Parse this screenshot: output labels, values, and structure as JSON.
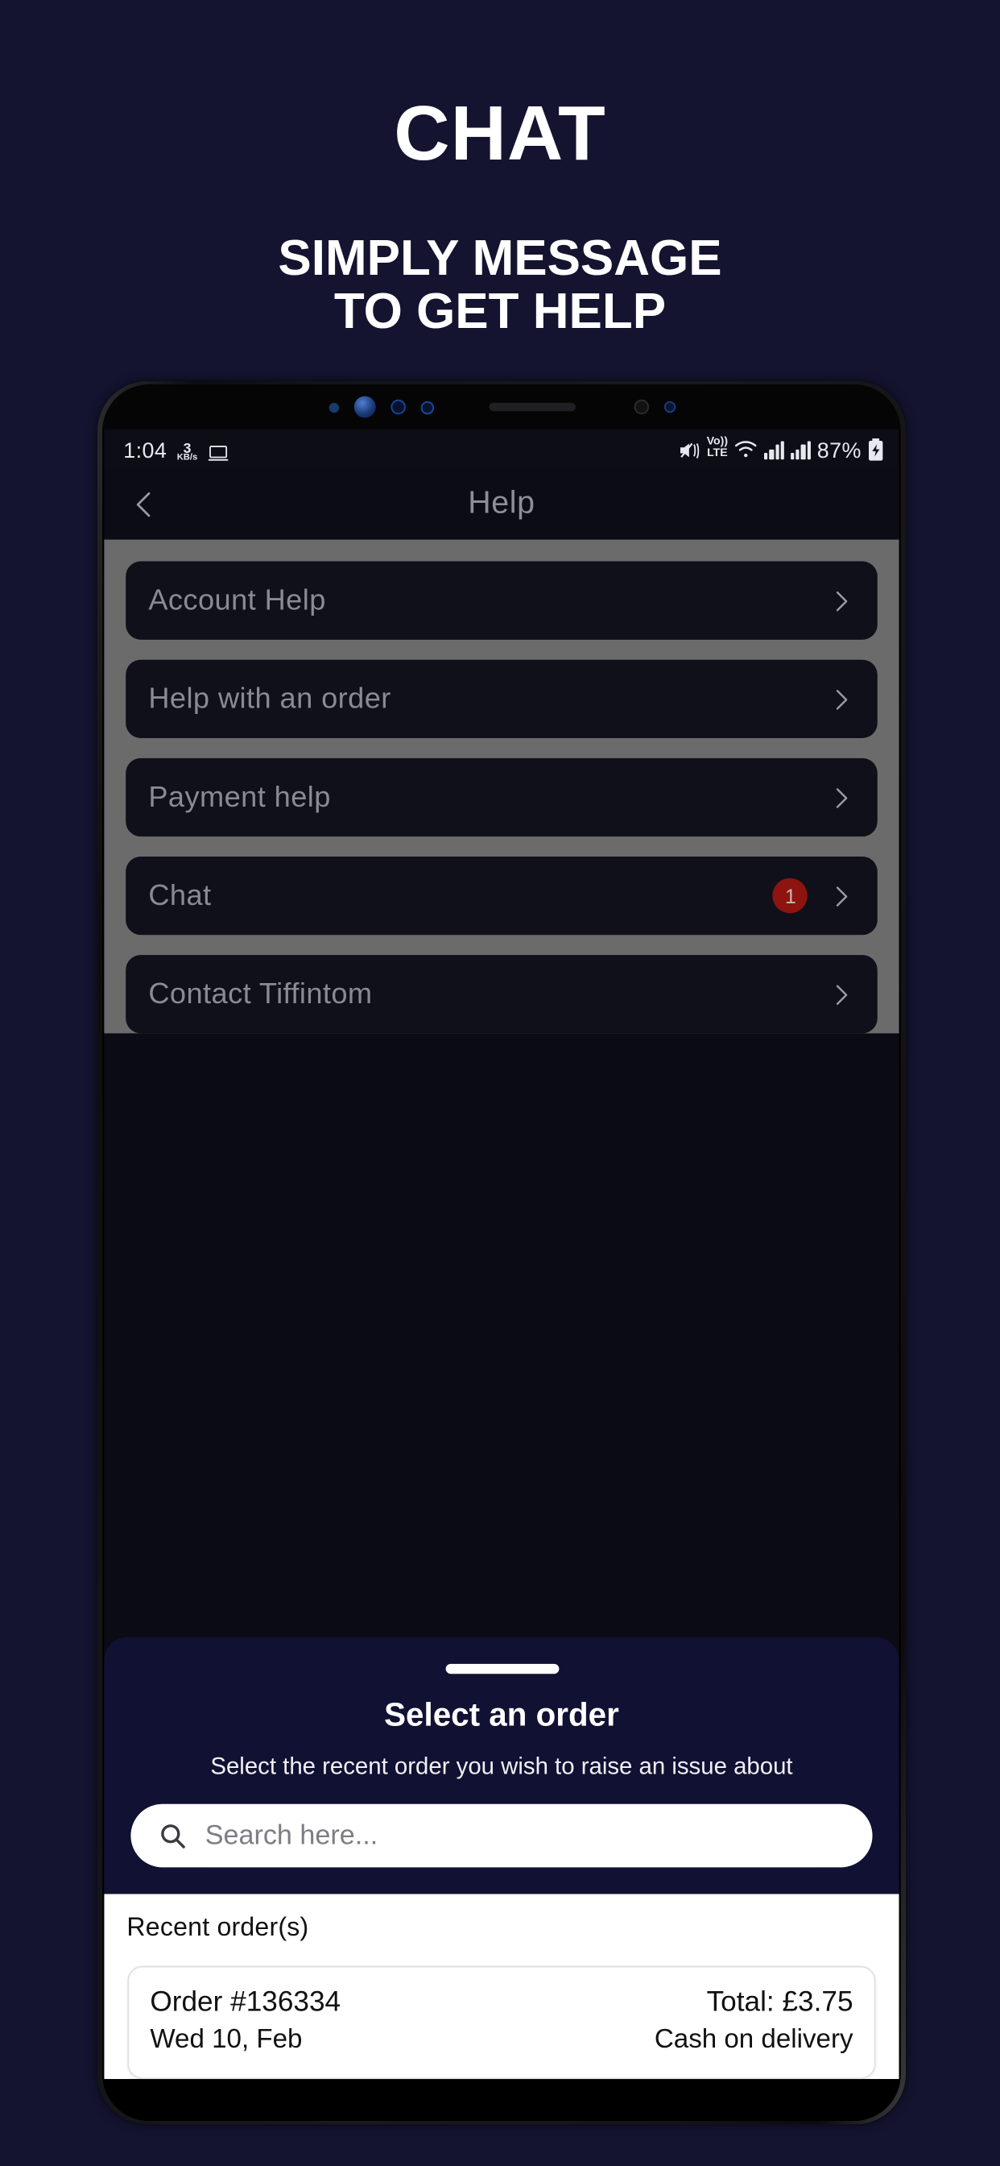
{
  "poster": {
    "headline": "CHAT",
    "subhead_line1": "SIMPLY MESSAGE",
    "subhead_line2": "TO GET HELP",
    "background_color": "#141431",
    "text_color": "#ffffff"
  },
  "status_bar": {
    "clock": "1:04",
    "net_speed_value": "3",
    "net_speed_unit": "KB/s",
    "laptop_icon": "laptop-icon",
    "mute_icon": "mute-vibrate-icon",
    "volte_line1": "Vo))",
    "volte_line2": "LTE",
    "wifi_icon": "wifi-icon",
    "signal_icon_1": "signal-bars-icon",
    "signal_icon_2": "signal-bars-icon",
    "battery_percent": "87%",
    "battery_icon": "battery-charging-icon"
  },
  "app_header": {
    "back_icon": "back-chevron-icon",
    "title": "Help"
  },
  "help_list": {
    "items": [
      {
        "label": "Account Help",
        "badge": null,
        "chevron": "chevron-right-icon"
      },
      {
        "label": "Help with an order",
        "badge": null,
        "chevron": "chevron-right-icon"
      },
      {
        "label": "Payment help",
        "badge": null,
        "chevron": "chevron-right-icon"
      },
      {
        "label": "Chat",
        "badge": "1",
        "chevron": "chevron-right-icon"
      },
      {
        "label": "Contact Tiffintom",
        "badge": null,
        "chevron": "chevron-right-icon"
      }
    ],
    "badge_color": "#8e1410"
  },
  "sheet": {
    "grabber": "drag-handle",
    "title": "Select an order",
    "subtitle": "Select the recent order you wish to raise an issue about",
    "search_placeholder": "Search here...",
    "search_icon": "search-icon",
    "background_color": "#111133"
  },
  "orders_section": {
    "heading": "Recent order(s)",
    "orders": [
      {
        "order_number": "Order #136334",
        "date": "Wed 10, Feb",
        "total": "Total: £3.75",
        "payment_method": "Cash on delivery"
      }
    ]
  }
}
